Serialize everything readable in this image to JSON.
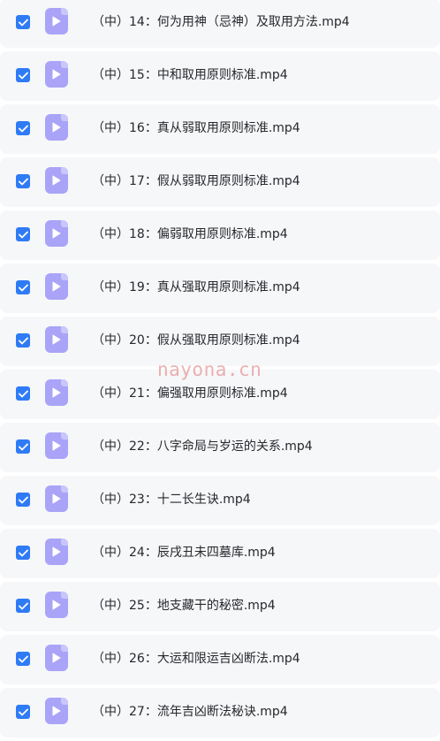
{
  "colors": {
    "checkbox": "#2f7bf5",
    "icon": "#a9a4f7",
    "row_bg": "#f6f7f9",
    "text": "#26282c",
    "watermark": "#d64848"
  },
  "icons": {
    "checkbox": "checkmark-icon",
    "file": "video-file-play-icon"
  },
  "files": [
    {
      "name": "（中）14：何为用神（忌神）及取用方法.mp4",
      "checked": true
    },
    {
      "name": "（中）15：中和取用原则标准.mp4",
      "checked": true
    },
    {
      "name": "（中）16：真从弱取用原则标准.mp4",
      "checked": true
    },
    {
      "name": "（中）17：假从弱取用原则标准.mp4",
      "checked": true
    },
    {
      "name": "（中）18：偏弱取用原则标准.mp4",
      "checked": true
    },
    {
      "name": "（中）19：真从强取用原则标准.mp4",
      "checked": true
    },
    {
      "name": "（中）20：假从强取用原则标准.mp4",
      "checked": true
    },
    {
      "name": "（中）21：偏强取用原则标准.mp4",
      "checked": true
    },
    {
      "name": "（中）22：八字命局与岁运的关系.mp4",
      "checked": true
    },
    {
      "name": "（中）23：十二长生诀.mp4",
      "checked": true
    },
    {
      "name": "（中）24：辰戌丑未四墓库.mp4",
      "checked": true
    },
    {
      "name": "（中）25：地支藏干的秘密.mp4",
      "checked": true
    },
    {
      "name": "（中）26：大运和限运吉凶断法.mp4",
      "checked": true
    },
    {
      "name": "（中）27：流年吉凶断法秘诀.mp4",
      "checked": true
    }
  ],
  "watermark": "nayona.cn"
}
